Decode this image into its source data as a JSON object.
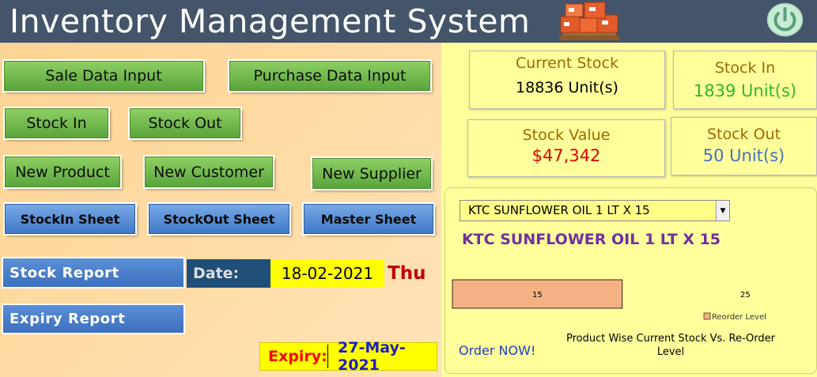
{
  "header": {
    "title": "Inventory Management System"
  },
  "buttons": {
    "sale_data_input": "Sale Data Input",
    "purchase_data_input": "Purchase Data Input",
    "stock_in": "Stock In",
    "stock_out": "Stock Out",
    "new_product": "New Product",
    "new_customer": "New Customer",
    "new_supplier": "New Supplier",
    "stockin_sheet": "StockIn Sheet",
    "stockout_sheet": "StockOut Sheet",
    "master_sheet": "Master Sheet",
    "stock_report": "Stock Report",
    "expiry_report": "Expiry Report"
  },
  "date": {
    "label": "Date:",
    "value": "18-02-2021",
    "day": "Thu"
  },
  "expiry": {
    "label": "Expiry:",
    "value": "27-May-2021"
  },
  "cards": {
    "current_stock": {
      "title": "Current Stock",
      "value": "18836 Unit(s)"
    },
    "stock_in": {
      "title": "Stock In",
      "value": "1839 Unit(s)"
    },
    "stock_value": {
      "title": "Stock Value",
      "value": "$47,342"
    },
    "stock_out": {
      "title": "Stock Out",
      "value": "50 Unit(s)"
    }
  },
  "product": {
    "selected": "KTC SUNFLOWER OIL 1 LT X 15",
    "name": "KTC SUNFLOWER OIL 1 LT X 15",
    "order_now": "Order NOW!"
  },
  "colors": {
    "header_bg": "#44546a",
    "stock_in_value": "#2db82d",
    "stock_value_value": "#e00000",
    "stock_out_value": "#4472c4",
    "current_stock_value": "#000000",
    "bar_fill": "#f4b183",
    "reorder_marker": "#f4b183"
  },
  "icons": {
    "header_image": "cargo-boxes-icon",
    "exit": "power-icon"
  },
  "chart_data": {
    "type": "bar",
    "orientation": "horizontal",
    "title": "Product Wise Current Stock Vs. Re-Order Level",
    "series": [
      {
        "name": "",
        "values": [
          15
        ]
      }
    ],
    "reorder_level": 25,
    "data_labels": [
      "15"
    ],
    "reorder_label": "25",
    "legend": [
      {
        "name": "Reorder Level",
        "color": "#f4b183"
      }
    ],
    "legend_position": "bottom-right",
    "grid": false
  }
}
